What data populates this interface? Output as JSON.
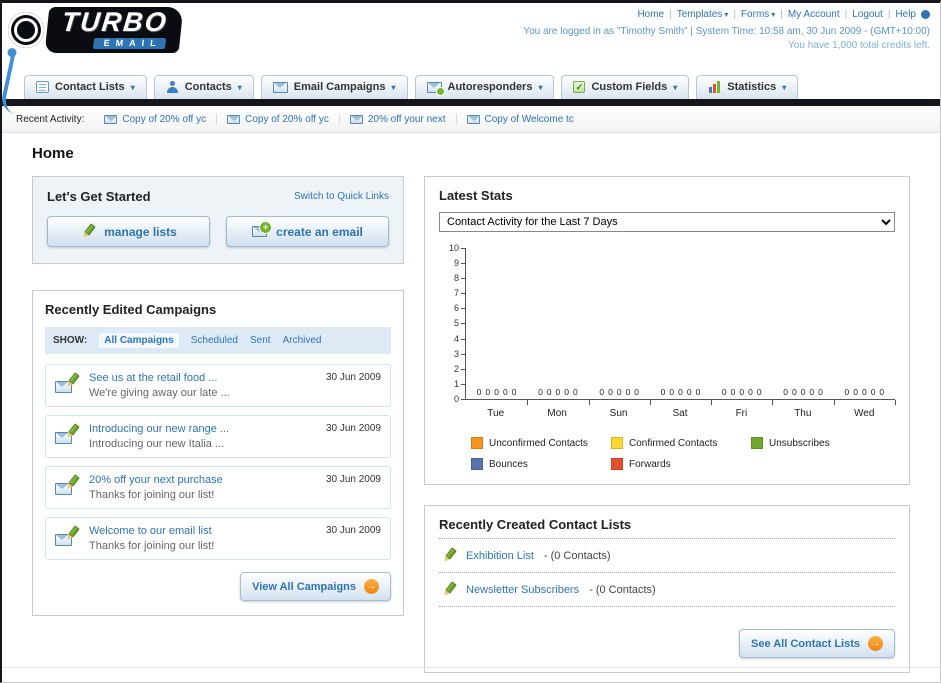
{
  "header": {
    "logo_primary": "TURBO",
    "logo_secondary": "EMAIL",
    "separator": "|",
    "top_links": [
      {
        "label": "Home",
        "dropdown": false
      },
      {
        "label": "Templates",
        "dropdown": true
      },
      {
        "label": "Forms",
        "dropdown": true
      },
      {
        "label": "My Account",
        "dropdown": false
      },
      {
        "label": "Logout",
        "dropdown": false
      },
      {
        "label": "Help",
        "dropdown": false
      }
    ],
    "login_info": "You are logged in as \"Timothy Smith\" | System Time: 10:58 am, 30 Jun 2009 - (GMT+10:00)",
    "credits": "You have 1,000 total credits left."
  },
  "nav": {
    "tabs": [
      {
        "label": "Contact Lists",
        "icon": "contact-lists-icon"
      },
      {
        "label": "Contacts",
        "icon": "contacts-icon"
      },
      {
        "label": "Email Campaigns",
        "icon": "email-campaigns-icon"
      },
      {
        "label": "Autoresponders",
        "icon": "autoresponders-icon"
      },
      {
        "label": "Custom Fields",
        "icon": "custom-fields-icon"
      },
      {
        "label": "Statistics",
        "icon": "statistics-icon"
      }
    ]
  },
  "recent_activity": {
    "label": "Recent Activity:",
    "items": [
      "Copy of 20% off yc",
      "Copy of 20% off yc",
      "20% off your next",
      "Copy of Welcome tc"
    ]
  },
  "page_title": "Home",
  "get_started": {
    "title": "Let's Get Started",
    "switch_link": "Switch to Quick Links",
    "manage_lists_label": "manage lists",
    "create_email_label": "create an email"
  },
  "campaigns": {
    "title": "Recently Edited Campaigns",
    "show_label": "SHOW:",
    "filters": [
      "All Campaigns",
      "Scheduled",
      "Sent",
      "Archived"
    ],
    "items": [
      {
        "title": "See us at the retail food ...",
        "subtitle": "We're giving away our late ...",
        "date": "30 Jun 2009"
      },
      {
        "title": "Introducing our new range ...",
        "subtitle": "Introducing our new Italia ...",
        "date": "30 Jun 2009"
      },
      {
        "title": "20% off your next purchase",
        "subtitle": "Thanks for joining our list!",
        "date": "30 Jun 2009"
      },
      {
        "title": "Welcome to our email list",
        "subtitle": "Thanks for joining our list!",
        "date": "30 Jun 2009"
      }
    ],
    "view_all_label": "View All Campaigns"
  },
  "stats": {
    "title": "Latest Stats",
    "dropdown_value": "Contact Activity for the Last 7 Days"
  },
  "chart_data": {
    "type": "bar",
    "title": "Contact Activity for the Last 7 Days",
    "categories": [
      "Tue",
      "Mon",
      "Sun",
      "Sat",
      "Fri",
      "Thu",
      "Wed"
    ],
    "series": [
      {
        "name": "Unconfirmed Contacts",
        "color": "#f7941d",
        "values": [
          0,
          0,
          0,
          0,
          0,
          0,
          0
        ]
      },
      {
        "name": "Confirmed Contacts",
        "color": "#ffd62e",
        "values": [
          0,
          0,
          0,
          0,
          0,
          0,
          0
        ]
      },
      {
        "name": "Unsubscribes",
        "color": "#6fa82c",
        "values": [
          0,
          0,
          0,
          0,
          0,
          0,
          0
        ]
      },
      {
        "name": "Bounces",
        "color": "#5674a8",
        "values": [
          0,
          0,
          0,
          0,
          0,
          0,
          0
        ]
      },
      {
        "name": "Forwards",
        "color": "#e2512c",
        "values": [
          0,
          0,
          0,
          0,
          0,
          0,
          0
        ]
      }
    ],
    "ylim": [
      0,
      10
    ],
    "ytick_step": 1,
    "grid": false,
    "legend_position": "bottom",
    "value_labels_shown": true
  },
  "contact_lists": {
    "title": "Recently Created Contact Lists",
    "items": [
      {
        "name": "Exhibition List",
        "detail": "- (0 Contacts)"
      },
      {
        "name": "Newsletter Subscribers",
        "detail": "- (0 Contacts)"
      }
    ],
    "see_all_label": "See All Contact Lists"
  }
}
